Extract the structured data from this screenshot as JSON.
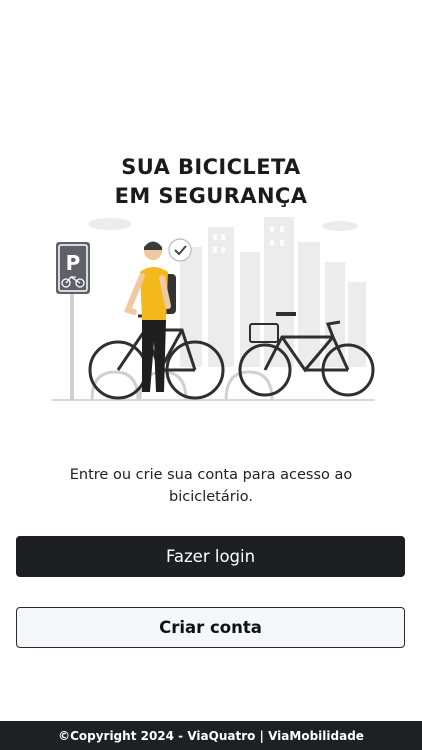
{
  "hero": {
    "title_line1": "SUA BICICLETA",
    "title_line2": "EM SEGURANÇA"
  },
  "illustration": {
    "icons": [
      "parking-sign-icon",
      "bicycle-icon",
      "check-icon"
    ]
  },
  "intro_text": "Entre ou crie sua conta para acesso ao bicicletário.",
  "actions": {
    "login_label": "Fazer login",
    "create_account_label": "Criar conta"
  },
  "footer": {
    "copyright": "©Copyright 2024 - ViaQuatro | ViaMobilidade"
  },
  "colors": {
    "primary_button": "#1d1f22",
    "secondary_button": "#f4f6f9",
    "accent_shirt": "#f5b81c",
    "footer_bg": "#1e2023"
  }
}
